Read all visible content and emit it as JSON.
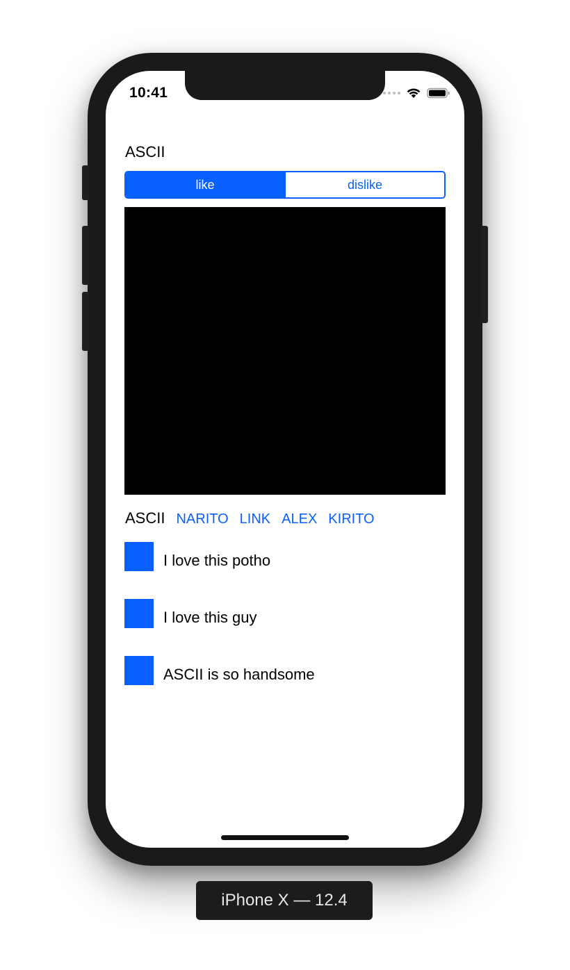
{
  "status_bar": {
    "time": "10:41",
    "icons": [
      "cellular-signal-icon",
      "wifi-icon",
      "battery-icon"
    ]
  },
  "header": {
    "title": "ASCII"
  },
  "segmented_control": {
    "segments": [
      {
        "label": "like",
        "selected": true
      },
      {
        "label": "dislike",
        "selected": false
      }
    ]
  },
  "image_view": {
    "color": "#000000"
  },
  "name_row": {
    "plain": "ASCII",
    "links": [
      "NARITO",
      "LINK",
      "ALEX",
      "KIRITO"
    ]
  },
  "comments": [
    {
      "text": "I love this potho"
    },
    {
      "text": "I love this guy"
    },
    {
      "text": "ASCII is so handsome"
    }
  ],
  "simulator": {
    "device_label": "iPhone X — 12.4"
  },
  "colors": {
    "accent": "#0a60ff",
    "text": "#000000",
    "background": "#ffffff"
  }
}
